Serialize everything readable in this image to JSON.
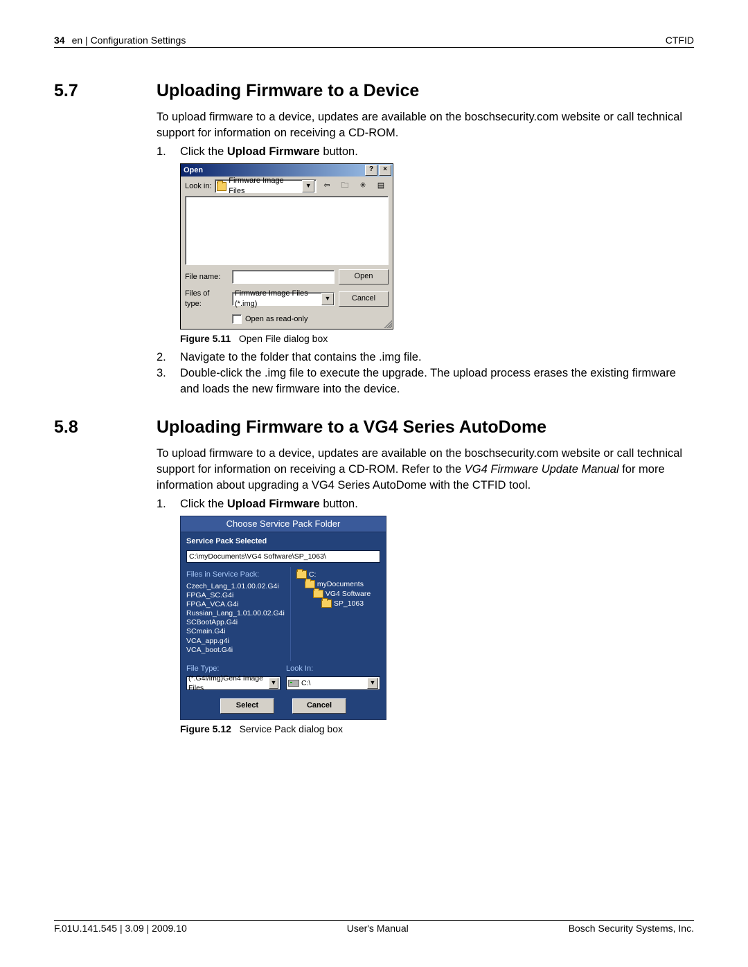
{
  "header": {
    "page_number": "34",
    "breadcrumb": "en | Configuration Settings",
    "right": "CTFID"
  },
  "section57": {
    "number": "5.7",
    "title": "Uploading Firmware to a Device",
    "intro1": "To upload firmware to a device, updates are available on the boschsecurity.com website or call technical support for information on receiving a CD-ROM.",
    "step1_n": "1.",
    "step1_a": "Click the ",
    "step1_bold": "Upload Firmware",
    "step1_c": " button.",
    "fig_label": "Figure 5.11",
    "fig_caption": "Open File dialog box",
    "step2_n": "2.",
    "step2": "Navigate to the folder that contains the .img file.",
    "step3_n": "3.",
    "step3": "Double-click the .img file to execute the upgrade. The upload process erases the existing firmware and loads the new firmware into the device."
  },
  "open_dialog": {
    "title": "Open",
    "help_btn": "?",
    "close_btn": "×",
    "look_in_label": "Look in:",
    "look_in_value": "Firmware Image Files",
    "nav_back": "⇦",
    "nav_up": "🗀",
    "nav_new": "✳",
    "nav_view": "▤",
    "file_name_label": "File name:",
    "file_name_value": "",
    "open_btn": "Open",
    "files_type_label": "Files of type:",
    "files_type_value": "Firmware Image Files (*.img)",
    "cancel_btn": "Cancel",
    "readonly_label": "Open as read-only"
  },
  "section58": {
    "number": "5.8",
    "title": "Uploading Firmware to a VG4 Series AutoDome",
    "intro_a": "To upload firmware to a device, updates are available on the boschsecurity.com website or call technical support for information on receiving a CD-ROM. Refer to the ",
    "intro_i1": "VG4 Firmware Update Manual",
    "intro_b": " for more information about upgrading a VG4 Series AutoDome with the CTFID tool.",
    "step1_n": "1.",
    "step1_a": "Click the ",
    "step1_bold": "Upload Firmware",
    "step1_c": " button.",
    "fig_label": "Figure 5.12",
    "fig_caption": "Service Pack dialog box"
  },
  "sp_dialog": {
    "title": "Choose Service Pack Folder",
    "subtitle": "Service Pack Selected",
    "path": "C:\\myDocuments\\VG4 Software\\SP_1063\\",
    "files_label": "Files in Service Pack:",
    "files": [
      "Czech_Lang_1.01.00.02.G4i",
      "FPGA_SC.G4i",
      "FPGA_VCA.G4i",
      "Russian_Lang_1.01.00.02.G4i",
      "SCBootApp.G4i",
      "SCmain.G4i",
      "VCA_app.g4i",
      "VCA_boot.G4i"
    ],
    "tree_root": "C:",
    "tree_l1": "myDocuments",
    "tree_l2": "VG4 Software",
    "tree_l3": "SP_1063",
    "file_type_label": "File Type:",
    "file_type_value": "(*.G4i/img)Gen4 Image Files",
    "look_in_label": "Look In:",
    "look_in_value": "C:\\",
    "select_btn": "Select",
    "cancel_btn": "Cancel"
  },
  "footer": {
    "left": "F.01U.141.545 | 3.09 | 2009.10",
    "center": "User's Manual",
    "right": "Bosch Security Systems, Inc."
  }
}
